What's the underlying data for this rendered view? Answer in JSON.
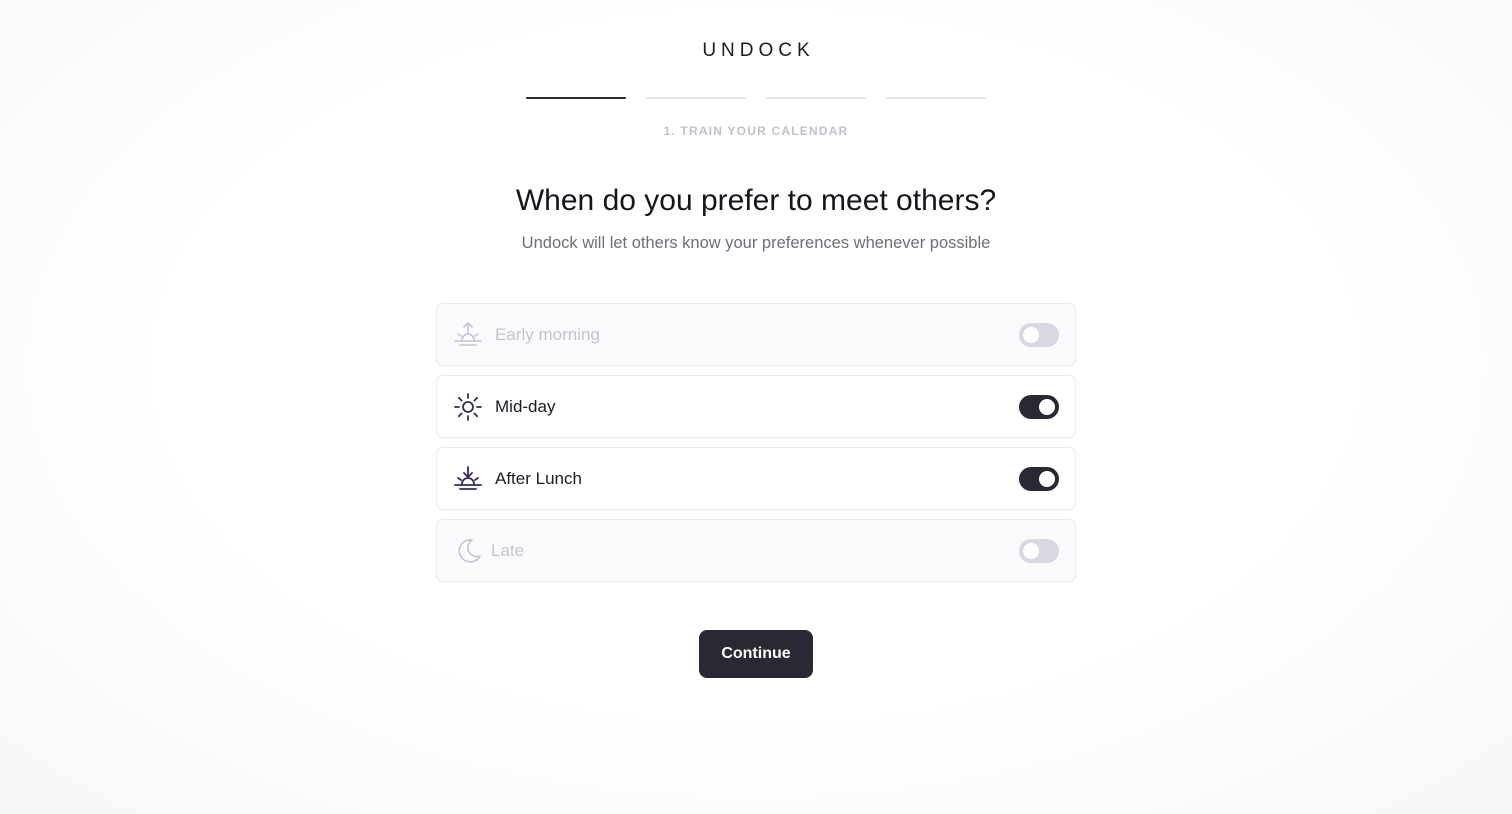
{
  "brand": {
    "logo_text": "UNDOCK"
  },
  "progress": {
    "total_steps": 4,
    "current_step": 1,
    "step_label": "1. TRAIN YOUR CALENDAR"
  },
  "heading": {
    "title": "When do you prefer to meet others?",
    "subtitle": "Undock will let others know your preferences whenever possible"
  },
  "options": [
    {
      "label": "Early morning",
      "icon": "sunrise-icon",
      "enabled": false
    },
    {
      "label": "Mid-day",
      "icon": "sun-icon",
      "enabled": true
    },
    {
      "label": "After Lunch",
      "icon": "sunset-icon",
      "enabled": true
    },
    {
      "label": "Late",
      "icon": "moon-icon",
      "enabled": false
    }
  ],
  "actions": {
    "continue_label": "Continue"
  },
  "colors": {
    "primary": "#2a2833",
    "icon_active": "#3a2a5c",
    "icon_inactive": "#cbbfdd",
    "toggle_off": "#d9d7e2"
  }
}
